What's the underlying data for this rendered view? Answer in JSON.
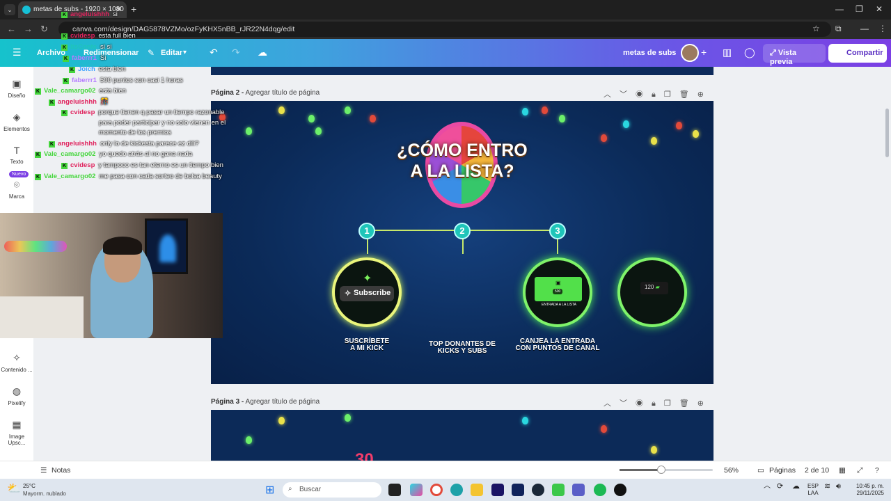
{
  "browser": {
    "tab_title": "metas de subs - 1920 × 1080",
    "url": "canva.com/design/DAG5878VZMo/ozFyKHX5nBB_rJR22N4dqg/edit"
  },
  "header": {
    "menu_file": "Archivo",
    "resize": "Redimensionar",
    "edit": "Editar",
    "design_name": "metas de subs",
    "preview": "Vista previa",
    "share": "Compartir"
  },
  "sidebar": {
    "items": [
      {
        "label": "Diseño",
        "icon": "layout-icon"
      },
      {
        "label": "Elementos",
        "icon": "shapes-icon"
      },
      {
        "label": "Texto",
        "icon": "text-icon"
      },
      {
        "label": "Marca",
        "icon": "brand-icon"
      },
      {
        "label": "Contenido ...",
        "icon": "magic-icon"
      },
      {
        "label": "Pixelify",
        "icon": "pixelify-icon"
      },
      {
        "label": "Image Upsc...",
        "icon": "upscale-icon"
      }
    ],
    "new_badge": "Nuevo"
  },
  "pages": {
    "page2_label": "Página 2 -",
    "page2_add": "Agregar título de página",
    "page3_label": "Página 3 -",
    "page3_add": "Agregar título de página"
  },
  "slide": {
    "title_line1": "¿CÓMO ENTRO",
    "title_line2": "A LA LISTA?",
    "steps": [
      "1",
      "2",
      "3"
    ],
    "subscribe_btn": "Subscribe",
    "ticket_points": "500",
    "ticket_label": "ENTRADA A LA LISTA",
    "mini_count": "120",
    "cap1_l1": "SUSCRÍBETE",
    "cap1_l2": "A MI KICK",
    "cap2_l1": "TOP DONANTES DE",
    "cap2_l2": "KICKS Y SUBS",
    "cap3_l1": "CANJEA LA ENTRADA",
    "cap3_l2": "CON PUNTOS DE CANAL",
    "page3_number": "30"
  },
  "chat": [
    {
      "user": "angeluishhh",
      "msg": "si",
      "color": "#e0245e"
    },
    {
      "user": "cvidesp",
      "msg": "esta full bien",
      "color": "#e0245e"
    },
    {
      "user": "ItsConte",
      "msg": "si si",
      "color": "#1ec5b9"
    },
    {
      "user": "faberrr1",
      "msg": "Si",
      "color": "#b57bff"
    },
    {
      "user": "Joich",
      "msg": "esta bien",
      "color": "#3aa0ff"
    },
    {
      "user": "faberrr1",
      "msg": "500 puntos son casi 1 horas",
      "color": "#b57bff"
    },
    {
      "user": "Vale_camargo02",
      "msg": "esta bien",
      "color": "#45d63c"
    },
    {
      "user": "angeluishhh",
      "msg": "🎊",
      "color": "#e0245e"
    },
    {
      "user": "cvidesp",
      "msg": "porque tienen q pasar un tiempo razonable",
      "color": "#e0245e"
    },
    {
      "user": "",
      "msg": "para poder participar y no solo vienen en el",
      "color": "#e0245e"
    },
    {
      "user": "",
      "msg": "momento de los premios",
      "color": "#e0245e"
    },
    {
      "user": "angeluishhh",
      "msg": "only lo de kickesta parece ez dili?",
      "color": "#e0245e"
    },
    {
      "user": "Vale_camargo02",
      "msg": "yo quedo atrás al no gana nada",
      "color": "#45d63c"
    },
    {
      "user": "cvidesp",
      "msg": "y tampoco es tan eterno es un tiempo bien",
      "color": "#e0245e"
    },
    {
      "user": "Vale_camargo02",
      "msg": "me pasa con cada sorteo de bolsa beauty",
      "color": "#45d63c"
    }
  ],
  "bottombar": {
    "notes": "Notas",
    "zoom": "56%",
    "pages": "Páginas",
    "page_count": "2 de 10",
    "zoom_fraction": 0.45
  },
  "taskbar": {
    "weather_temp": "25°C",
    "weather_desc": "Mayorm. nublado",
    "search": "Buscar",
    "lang1": "ESP",
    "lang2": "LAA",
    "time": "10:45 p. m.",
    "date": "29/11/2025"
  }
}
